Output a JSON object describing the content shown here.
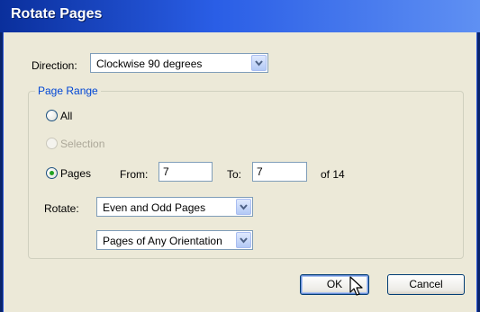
{
  "window": {
    "title": "Rotate Pages"
  },
  "direction": {
    "label": "Direction:",
    "value": "Clockwise 90 degrees"
  },
  "page_range": {
    "title": "Page Range",
    "all_label": "All",
    "selection_label": "Selection",
    "pages_label": "Pages",
    "from_label": "From:",
    "from_value": "7",
    "to_label": "To:",
    "to_value": "7",
    "of_text": "of 14",
    "selected": "Pages",
    "selection_enabled": false
  },
  "rotate": {
    "label": "Rotate:",
    "pages_value": "Even and Odd Pages",
    "orientation_value": "Pages of Any Orientation"
  },
  "buttons": {
    "ok": "OK",
    "cancel": "Cancel"
  },
  "colors": {
    "title_bar": "#2a5ee6",
    "group_title": "#0046d5",
    "radio_dot": "#21a121"
  },
  "icons": {
    "dropdown": "chevron-down-icon",
    "pointer": "mouse-cursor-icon"
  }
}
